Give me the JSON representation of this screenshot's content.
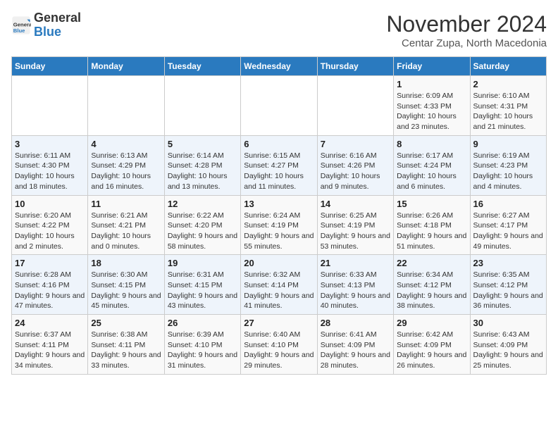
{
  "logo": {
    "general": "General",
    "blue": "Blue"
  },
  "title": "November 2024",
  "location": "Centar Zupa, North Macedonia",
  "weekdays": [
    "Sunday",
    "Monday",
    "Tuesday",
    "Wednesday",
    "Thursday",
    "Friday",
    "Saturday"
  ],
  "weeks": [
    [
      {
        "day": "",
        "info": ""
      },
      {
        "day": "",
        "info": ""
      },
      {
        "day": "",
        "info": ""
      },
      {
        "day": "",
        "info": ""
      },
      {
        "day": "",
        "info": ""
      },
      {
        "day": "1",
        "info": "Sunrise: 6:09 AM\nSunset: 4:33 PM\nDaylight: 10 hours and 23 minutes."
      },
      {
        "day": "2",
        "info": "Sunrise: 6:10 AM\nSunset: 4:31 PM\nDaylight: 10 hours and 21 minutes."
      }
    ],
    [
      {
        "day": "3",
        "info": "Sunrise: 6:11 AM\nSunset: 4:30 PM\nDaylight: 10 hours and 18 minutes."
      },
      {
        "day": "4",
        "info": "Sunrise: 6:13 AM\nSunset: 4:29 PM\nDaylight: 10 hours and 16 minutes."
      },
      {
        "day": "5",
        "info": "Sunrise: 6:14 AM\nSunset: 4:28 PM\nDaylight: 10 hours and 13 minutes."
      },
      {
        "day": "6",
        "info": "Sunrise: 6:15 AM\nSunset: 4:27 PM\nDaylight: 10 hours and 11 minutes."
      },
      {
        "day": "7",
        "info": "Sunrise: 6:16 AM\nSunset: 4:26 PM\nDaylight: 10 hours and 9 minutes."
      },
      {
        "day": "8",
        "info": "Sunrise: 6:17 AM\nSunset: 4:24 PM\nDaylight: 10 hours and 6 minutes."
      },
      {
        "day": "9",
        "info": "Sunrise: 6:19 AM\nSunset: 4:23 PM\nDaylight: 10 hours and 4 minutes."
      }
    ],
    [
      {
        "day": "10",
        "info": "Sunrise: 6:20 AM\nSunset: 4:22 PM\nDaylight: 10 hours and 2 minutes."
      },
      {
        "day": "11",
        "info": "Sunrise: 6:21 AM\nSunset: 4:21 PM\nDaylight: 10 hours and 0 minutes."
      },
      {
        "day": "12",
        "info": "Sunrise: 6:22 AM\nSunset: 4:20 PM\nDaylight: 9 hours and 58 minutes."
      },
      {
        "day": "13",
        "info": "Sunrise: 6:24 AM\nSunset: 4:19 PM\nDaylight: 9 hours and 55 minutes."
      },
      {
        "day": "14",
        "info": "Sunrise: 6:25 AM\nSunset: 4:19 PM\nDaylight: 9 hours and 53 minutes."
      },
      {
        "day": "15",
        "info": "Sunrise: 6:26 AM\nSunset: 4:18 PM\nDaylight: 9 hours and 51 minutes."
      },
      {
        "day": "16",
        "info": "Sunrise: 6:27 AM\nSunset: 4:17 PM\nDaylight: 9 hours and 49 minutes."
      }
    ],
    [
      {
        "day": "17",
        "info": "Sunrise: 6:28 AM\nSunset: 4:16 PM\nDaylight: 9 hours and 47 minutes."
      },
      {
        "day": "18",
        "info": "Sunrise: 6:30 AM\nSunset: 4:15 PM\nDaylight: 9 hours and 45 minutes."
      },
      {
        "day": "19",
        "info": "Sunrise: 6:31 AM\nSunset: 4:15 PM\nDaylight: 9 hours and 43 minutes."
      },
      {
        "day": "20",
        "info": "Sunrise: 6:32 AM\nSunset: 4:14 PM\nDaylight: 9 hours and 41 minutes."
      },
      {
        "day": "21",
        "info": "Sunrise: 6:33 AM\nSunset: 4:13 PM\nDaylight: 9 hours and 40 minutes."
      },
      {
        "day": "22",
        "info": "Sunrise: 6:34 AM\nSunset: 4:12 PM\nDaylight: 9 hours and 38 minutes."
      },
      {
        "day": "23",
        "info": "Sunrise: 6:35 AM\nSunset: 4:12 PM\nDaylight: 9 hours and 36 minutes."
      }
    ],
    [
      {
        "day": "24",
        "info": "Sunrise: 6:37 AM\nSunset: 4:11 PM\nDaylight: 9 hours and 34 minutes."
      },
      {
        "day": "25",
        "info": "Sunrise: 6:38 AM\nSunset: 4:11 PM\nDaylight: 9 hours and 33 minutes."
      },
      {
        "day": "26",
        "info": "Sunrise: 6:39 AM\nSunset: 4:10 PM\nDaylight: 9 hours and 31 minutes."
      },
      {
        "day": "27",
        "info": "Sunrise: 6:40 AM\nSunset: 4:10 PM\nDaylight: 9 hours and 29 minutes."
      },
      {
        "day": "28",
        "info": "Sunrise: 6:41 AM\nSunset: 4:09 PM\nDaylight: 9 hours and 28 minutes."
      },
      {
        "day": "29",
        "info": "Sunrise: 6:42 AM\nSunset: 4:09 PM\nDaylight: 9 hours and 26 minutes."
      },
      {
        "day": "30",
        "info": "Sunrise: 6:43 AM\nSunset: 4:09 PM\nDaylight: 9 hours and 25 minutes."
      }
    ]
  ]
}
